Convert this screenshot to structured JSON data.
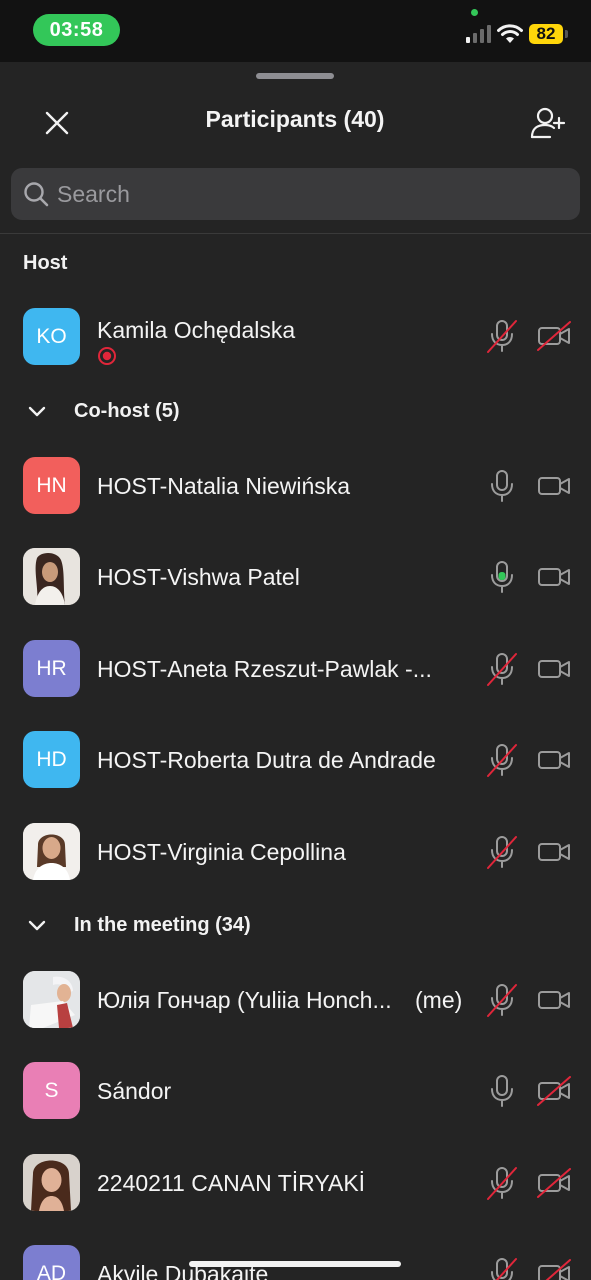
{
  "status_bar": {
    "time": "03:58",
    "battery": "82"
  },
  "header": {
    "title": "Participants (40)"
  },
  "search": {
    "placeholder": "Search"
  },
  "sections": {
    "host_label": "Host",
    "cohost_label": "Co-host (5)",
    "meeting_label": "In the meeting (34)"
  },
  "colors": {
    "accent_green": "#33c759",
    "muted_red": "#e0263a",
    "battery_yellow": "#ffd60a"
  },
  "participants": [
    {
      "initials": "KO",
      "name": "Kamila Ochędalska",
      "avatar_color": "#3fb7f0",
      "mic": "muted",
      "video": "off",
      "recording_icon": "record-icon"
    },
    {
      "initials": "HN",
      "name": "HOST-Natalia Niewińska",
      "avatar_color": "#f25f5c",
      "mic": "on",
      "video": "on"
    },
    {
      "initials": "",
      "name": "HOST-Vishwa Patel",
      "avatar_type": "photo",
      "mic": "active",
      "video": "on"
    },
    {
      "initials": "HR",
      "name": "HOST-Aneta Rzeszut-Pawlak -...",
      "avatar_color": "#7c7ed0",
      "mic": "muted",
      "video": "on"
    },
    {
      "initials": "HD",
      "name": "HOST-Roberta Dutra de Andrade",
      "avatar_color": "#3fb7f0",
      "mic": "muted",
      "video": "on"
    },
    {
      "initials": "",
      "name": "HOST-Virginia Cepollina",
      "avatar_type": "photo",
      "mic": "muted",
      "video": "on"
    },
    {
      "initials": "",
      "name": "Юлія Гончар (Yuliia Honch...",
      "me_label": "(me)",
      "avatar_type": "photo",
      "mic": "muted",
      "video": "on"
    },
    {
      "initials": "S",
      "name": "Sándor",
      "avatar_color": "#e97fb5",
      "mic": "on",
      "video": "off"
    },
    {
      "initials": "",
      "name": "2240211 CANAN TİRYAKİ",
      "avatar_type": "photo",
      "mic": "muted",
      "video": "off"
    },
    {
      "initials": "AD",
      "name": "Akvile Dubakaite",
      "avatar_color": "#7c7ed0",
      "mic": "muted",
      "video": "off"
    }
  ]
}
